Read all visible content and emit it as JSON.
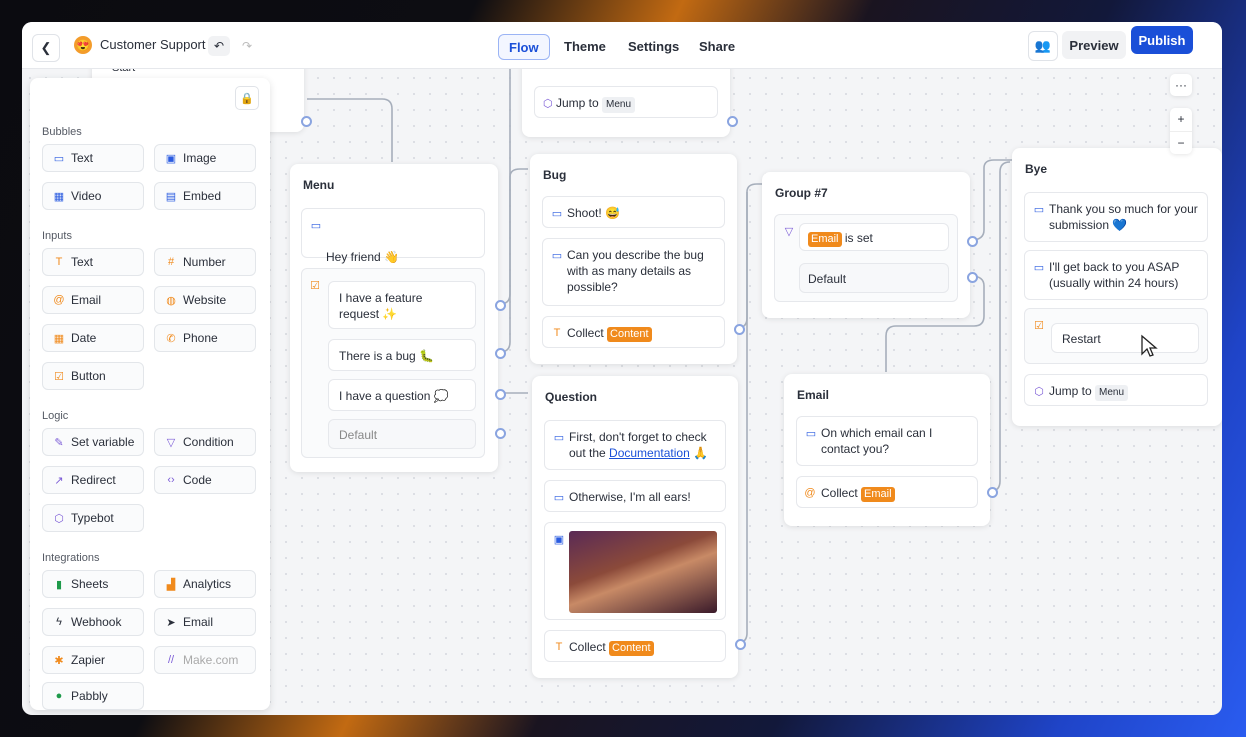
{
  "header": {
    "bot_name": "Customer Support",
    "tabs": [
      "Flow",
      "Theme",
      "Settings",
      "Share"
    ],
    "active_tab": "Flow",
    "preview_label": "Preview",
    "publish_label": "Publish"
  },
  "sidebar": {
    "bubbles_label": "Bubbles",
    "bubbles": [
      "Text",
      "Image",
      "Video",
      "Embed"
    ],
    "inputs_label": "Inputs",
    "inputs": [
      "Text",
      "Number",
      "Email",
      "Website",
      "Date",
      "Phone",
      "Button"
    ],
    "logic_label": "Logic",
    "logic": [
      "Set variable",
      "Condition",
      "Redirect",
      "Code",
      "Typebot"
    ],
    "integrations_label": "Integrations",
    "integrations": [
      "Sheets",
      "Analytics",
      "Webhook",
      "Email",
      "Zapier",
      "Make.com",
      "Pabbly"
    ]
  },
  "canvas": {
    "start_label": "Start",
    "top_jump": {
      "prefix": "Jump to",
      "target": "Menu"
    },
    "menu": {
      "title": "Menu",
      "message": "Hey friend 👋\nHow can I help you?",
      "choices": [
        "I have a feature request ✨",
        "There is a bug 🐛",
        "I have a question 💭"
      ],
      "default": "Default"
    },
    "bug": {
      "title": "Bug",
      "msg1": "Shoot! 😅",
      "msg2": "Can you describe the bug with as many details as possible?",
      "collect": "Collect",
      "var": "Content"
    },
    "question": {
      "title": "Question",
      "msg1_a": "First, don't forget to check out the",
      "msg1_link": "Documentation",
      "msg1_emoji": "🙏",
      "msg2": "Otherwise, I'm all ears!",
      "collect": "Collect",
      "var": "Content"
    },
    "group7": {
      "title": "Group #7",
      "cond_var": "Email",
      "cond_text": "is set",
      "default": "Default"
    },
    "email": {
      "title": "Email",
      "msg": "On which email can I contact you?",
      "collect": "Collect",
      "var": "Email"
    },
    "bye": {
      "title": "Bye",
      "msg1": "Thank you so much for your submission 💙",
      "msg2": "I'll get back to you ASAP (usually within 24 hours)",
      "restart": "Restart",
      "jump_prefix": "Jump to",
      "jump_target": "Menu"
    }
  },
  "zoom": {
    "more": "···",
    "plus": "+",
    "minus": "−"
  }
}
